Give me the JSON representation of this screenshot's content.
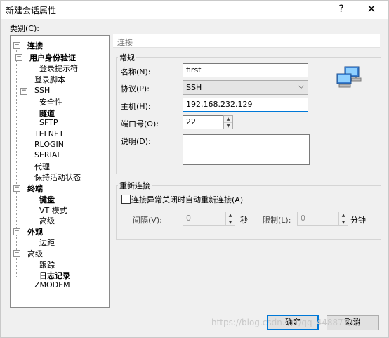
{
  "window": {
    "title": "新建会话属性",
    "help_label": "?",
    "close_label": "✕"
  },
  "category": {
    "label": "类别(C):",
    "tree": [
      {
        "label": "连接",
        "bold": true,
        "expander": "−"
      },
      {
        "label": "用户身份验证",
        "bold": true,
        "expander": "−"
      },
      {
        "label": "登录提示符",
        "bold": false
      },
      {
        "label": "登录脚本",
        "bold": false
      },
      {
        "label": "SSH",
        "bold": false,
        "expander": "−"
      },
      {
        "label": "安全性",
        "bold": false
      },
      {
        "label": "隧道",
        "bold": true
      },
      {
        "label": "SFTP",
        "bold": false
      },
      {
        "label": "TELNET",
        "bold": false
      },
      {
        "label": "RLOGIN",
        "bold": false
      },
      {
        "label": "SERIAL",
        "bold": false
      },
      {
        "label": "代理",
        "bold": false
      },
      {
        "label": "保持活动状态",
        "bold": false
      },
      {
        "label": "终端",
        "bold": true,
        "expander": "−"
      },
      {
        "label": "键盘",
        "bold": true
      },
      {
        "label": "VT 模式",
        "bold": false
      },
      {
        "label": "高级",
        "bold": false
      },
      {
        "label": "外观",
        "bold": true,
        "expander": "−"
      },
      {
        "label": "边距",
        "bold": false
      },
      {
        "label": "高级",
        "bold": false,
        "expander": "−"
      },
      {
        "label": "跟踪",
        "bold": false
      },
      {
        "label": "日志记录",
        "bold": true
      },
      {
        "label": "ZMODEM",
        "bold": false
      }
    ]
  },
  "panel": {
    "header": "连接",
    "general": {
      "title": "常规",
      "name_label": "名称(N):",
      "name_value": "first",
      "protocol_label": "协议(P):",
      "protocol_value": "SSH",
      "host_label": "主机(H):",
      "host_value": "192.168.232.129",
      "port_label": "端口号(O):",
      "port_value": "22",
      "desc_label": "说明(D):",
      "desc_value": ""
    },
    "reconnect": {
      "title": "重新连接",
      "checkbox_label": "连接异常关闭时自动重新连接(A)",
      "interval_label": "间隔(V):",
      "interval_value": "0",
      "seconds_label": "秒",
      "limit_label": "限制(L):",
      "limit_value": "0",
      "minutes_label": "分钟"
    }
  },
  "buttons": {
    "ok": "确定",
    "cancel": "取消"
  },
  "watermark": "https://blog.csdn.net/qq_44887788"
}
